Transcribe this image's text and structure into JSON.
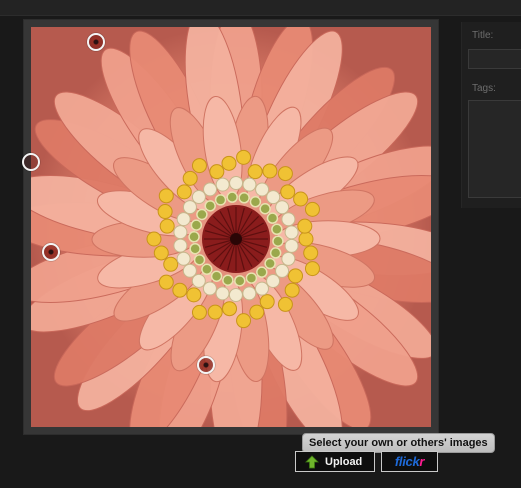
{
  "side_panel": {
    "title_label": "Title:",
    "title_value": "",
    "tags_label": "Tags:",
    "tags_value": ""
  },
  "photo": {
    "subject": "flower",
    "hotspot_count": 4
  },
  "tooltip": {
    "text": "Select your own or others' images"
  },
  "buttons": {
    "upload_label": "Upload",
    "upload_icon": "green-up-arrow-icon",
    "flickr_part1": "flick",
    "flickr_part2": "r",
    "flickr_color_blue": "#1e6ad9",
    "flickr_color_pink": "#ff1c92"
  },
  "colors": {
    "background": "#191919",
    "frame": "#363636",
    "tooltip_bg": "#c8c8c8"
  }
}
